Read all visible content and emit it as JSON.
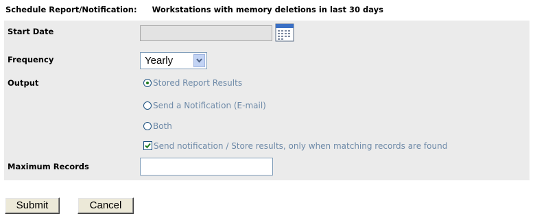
{
  "header": {
    "prefix": "Schedule Report/Notification:",
    "report_name": "Workstations with memory deletions in last 30 days"
  },
  "form": {
    "start_date": {
      "label": "Start Date",
      "value": ""
    },
    "frequency": {
      "label": "Frequency",
      "selected": "Yearly"
    },
    "output": {
      "label": "Output",
      "options": [
        {
          "label": "Stored Report Results",
          "selected": true
        },
        {
          "label": "Send a Notification (E-mail)",
          "selected": false
        },
        {
          "label": "Both",
          "selected": false
        }
      ],
      "only_when_matching": {
        "label": "Send notification / Store results, only when matching records are found",
        "checked": true
      }
    },
    "max_records": {
      "label": "Maximum Records",
      "value": ""
    }
  },
  "buttons": {
    "submit": "Submit",
    "cancel": "Cancel"
  },
  "icons": {
    "calendar": "calendar-icon",
    "dropdown": "chevron-down-icon"
  },
  "colors": {
    "form_bg": "#ebebeb",
    "option_text": "#6e8aa8"
  }
}
